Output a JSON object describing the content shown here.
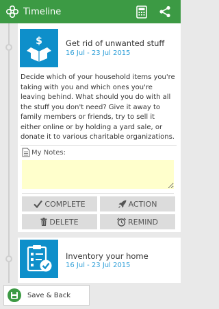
{
  "app": {
    "title": "Timeline"
  },
  "tasks": [
    {
      "title": "Get rid of unwanted stuff",
      "date": "16 Jul - 23 Jul 2015",
      "description": "Decide which of your household items you're taking with you and which ones you're leaving behind. What should you do with all the stuff you don't need? Give it away to family members or friends, try to sell it either online or by holding a yard sale, or donate it to various charitable organizations.",
      "notes_label": "My Notes:",
      "notes_value": "",
      "actions": {
        "complete": "COMPLETE",
        "action": "ACTION",
        "delete": "DELETE",
        "remind": "REMIND"
      }
    },
    {
      "title": "Inventory your home",
      "date": "16 Jul - 23 Jul 2015"
    }
  ],
  "footer": {
    "save_back": "Save & Back"
  },
  "icons": {
    "logo": "flower-logo-icon",
    "calculator": "calculator-icon",
    "share": "share-icon",
    "task1": "dollar-box-icon",
    "task2": "checklist-clipboard-icon",
    "notes": "document-icon",
    "complete": "check-icon",
    "action": "rocket-icon",
    "delete": "trash-icon",
    "remind": "alarm-clock-icon",
    "save": "save-disk-icon"
  },
  "colors": {
    "appbar": "#3c9a44",
    "accent": "#2e9fd8",
    "icon_bg": "#0e8fca",
    "notes_bg": "#ffffcc"
  }
}
